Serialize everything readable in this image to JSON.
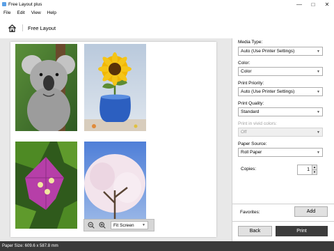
{
  "window": {
    "title": "Free Layout plus",
    "controls": {
      "minimize": "—",
      "maximize": "□",
      "close": "✕"
    }
  },
  "menu": [
    "File",
    "Edit",
    "View",
    "Help"
  ],
  "breadcrumb": {
    "home_icon": "home-icon",
    "current": "Free Layout"
  },
  "preview": {
    "photos": [
      "koala",
      "sunflower",
      "bougainvillea",
      "cherry-blossom"
    ],
    "zoom_select": "Fit Screen"
  },
  "settings": {
    "media_type": {
      "label": "Media Type:",
      "value": "Auto (Use Printer Settings)"
    },
    "color": {
      "label": "Color:",
      "value": "Color"
    },
    "print_priority": {
      "label": "Print Priority:",
      "value": "Auto (Use Printer Settings)"
    },
    "print_quality": {
      "label": "Print Quality:",
      "value": "Standard"
    },
    "vivid_colors": {
      "label": "Print in vivid colors:",
      "value": "Off"
    },
    "paper_source": {
      "label": "Paper Source:",
      "value": "Roll Paper"
    },
    "copies": {
      "label": "Copies:",
      "value": "1"
    }
  },
  "favorites": {
    "label": "Favorites:",
    "add_button": "Add"
  },
  "actions": {
    "back": "Back",
    "print": "Print"
  },
  "status": {
    "paper_size": "Paper Size: 609.6 x 587.8 mm"
  }
}
